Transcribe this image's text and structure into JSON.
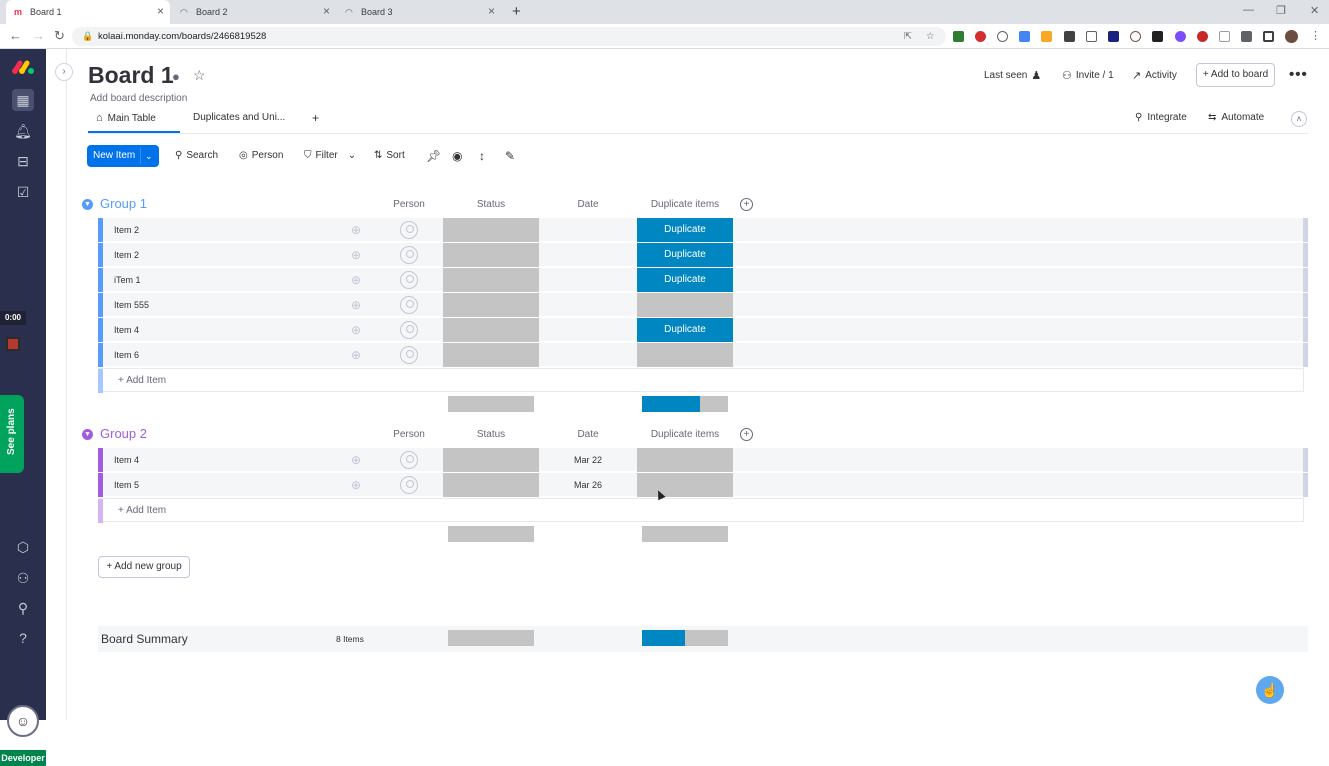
{
  "browser": {
    "tabs": [
      {
        "title": "Board 1",
        "active": true
      },
      {
        "title": "Board 2",
        "active": false
      },
      {
        "title": "Board 3",
        "active": false
      }
    ],
    "new_tab": "+",
    "url": "kolaai.monday.com/boards/2466819528"
  },
  "rail": {
    "timer": "0:00",
    "see_plans": "See plans",
    "developer": "Developer"
  },
  "board": {
    "title": "Board 1",
    "description": "Add board description",
    "last_seen": "Last seen",
    "invite": "Invite / 1",
    "activity": "Activity",
    "add_to_board": "Add to board",
    "more": "•••"
  },
  "views": {
    "tabs": [
      "Main Table",
      "Duplicates and Uni..."
    ],
    "add": "+",
    "integrate": "Integrate",
    "automate": "Automate"
  },
  "toolbar": {
    "new_item": "New Item",
    "search": "Search",
    "person": "Person",
    "filter": "Filter",
    "sort": "Sort"
  },
  "columns": [
    "Person",
    "Status",
    "Date",
    "Duplicate items"
  ],
  "colors": {
    "group1": "#579bfc",
    "group2": "#a25ddc",
    "duplicate": "#0086c0",
    "empty": "#c4c4c4",
    "primary": "#0073ea"
  },
  "groups": [
    {
      "title": "Group 1",
      "color": "#579bfc",
      "items": [
        {
          "name": "Item 2",
          "date": "",
          "duplicate": "Duplicate"
        },
        {
          "name": "Item 2",
          "date": "",
          "duplicate": "Duplicate"
        },
        {
          "name": "iTem 1",
          "date": "",
          "duplicate": "Duplicate"
        },
        {
          "name": "Item 555",
          "date": "",
          "duplicate": ""
        },
        {
          "name": "Item 4",
          "date": "",
          "duplicate": "Duplicate"
        },
        {
          "name": "Item 6",
          "date": "",
          "duplicate": ""
        }
      ],
      "add_item": "+ Add Item",
      "duplicate_share": 0.67
    },
    {
      "title": "Group 2",
      "color": "#a25ddc",
      "items": [
        {
          "name": "Item 4",
          "date": "Mar 22",
          "duplicate": ""
        },
        {
          "name": "Item 5",
          "date": "Mar 26",
          "duplicate": ""
        }
      ],
      "add_item": "+ Add Item",
      "duplicate_share": 0
    }
  ],
  "add_new_group": "Add new group",
  "summary": {
    "title": "Board Summary",
    "count": "8 Items",
    "duplicate_share": 0.5
  }
}
